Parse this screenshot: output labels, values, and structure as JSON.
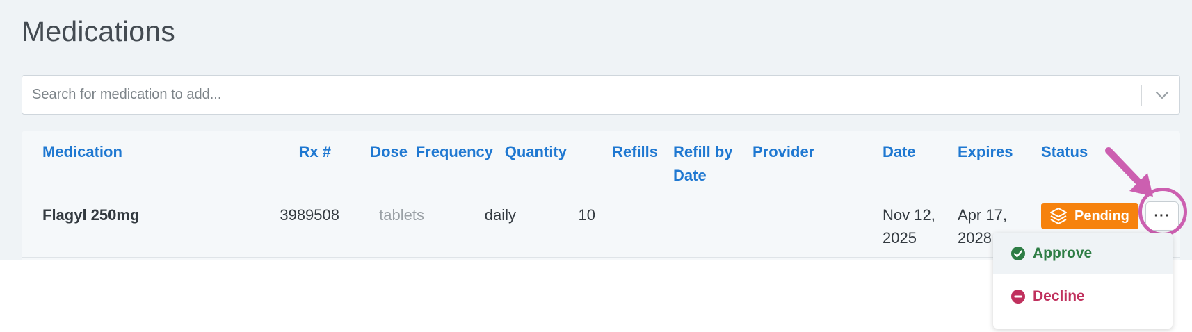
{
  "page": {
    "title": "Medications"
  },
  "search": {
    "placeholder": "Search for medication to add..."
  },
  "table": {
    "headers": {
      "medication": "Medication",
      "rx": "Rx #",
      "dose": "Dose",
      "frequency": "Frequency",
      "quantity": "Quantity",
      "refills": "Refills",
      "refill_by_date_1": "Refill by",
      "refill_by_date_2": "Date",
      "provider": "Provider",
      "date": "Date",
      "expires": "Expires",
      "status": "Status"
    },
    "rows": [
      {
        "medication": "Flagyl 250mg",
        "rx": "3989508",
        "dose": "tablets",
        "frequency": "daily",
        "quantity": "10",
        "refills": "",
        "refill_by_date": "",
        "provider": "",
        "date_1": "Nov 12,",
        "date_2": "2025",
        "expires_1": "Apr 17,",
        "expires_2": "2028",
        "status": "Pending",
        "more": "···"
      }
    ]
  },
  "menu": {
    "approve": "Approve",
    "decline": "Decline"
  },
  "colors": {
    "accent": "#1f78d1",
    "pending": "#f6820d",
    "approve": "#2e7d45",
    "decline": "#c0305d",
    "highlight": "#cc5fb0"
  },
  "icons": {
    "search_dropdown": "chevron-down-icon",
    "status": "layers-icon",
    "approve": "check-circle-icon",
    "decline": "minus-circle-icon",
    "more": "ellipsis-icon"
  }
}
